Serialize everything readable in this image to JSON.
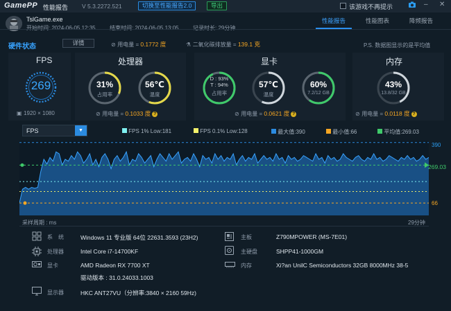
{
  "titlebar": {
    "brand": "GamePP",
    "brand_part1": "Game",
    "brand_part2": "PP",
    "name": "性能报告",
    "version": "V 5.3.2272.521",
    "switch_btn": "切换至性能报告2.0",
    "export_btn": "导出",
    "no_prompt_label": "该游戏不再提示"
  },
  "header": {
    "file_name": "TslGame.exe",
    "start_time": "开始时间: 2024-06-05 12:35",
    "end_time": "结束时间: 2024-06-05 13:05",
    "record_time": "记录时长: 29分钟",
    "tabs": [
      "性能报告",
      "性能图表",
      "降频报告"
    ]
  },
  "hw": {
    "label": "硬件状态",
    "detail_btn": "详情",
    "power_prefix": "用电量 = ",
    "power_value": "0.1772 度",
    "co2_prefix": "二氧化碳排放量 = ",
    "co2_value": "139.1 克",
    "note": "P.S. 数据图显示的是平均值"
  },
  "fps": {
    "title": "FPS",
    "value": "269",
    "resolution": "1920 × 1080"
  },
  "cpu": {
    "title": "处理器",
    "usage": "31%",
    "usage_label": "占用率",
    "usage_fraction": 0.31,
    "temp": "56℃",
    "temp_label": "温度",
    "temp_fraction": 0.56,
    "power_prefix": "用电量 = ",
    "power_value": "0.1033 度"
  },
  "gpu": {
    "title": "显卡",
    "d": "D : 93%",
    "t": "T : 94%",
    "usage_label": "占用率",
    "usage_fraction": 0.93,
    "temp": "57℃",
    "temp_label": "温度",
    "temp_fraction": 0.57,
    "vram": "60%",
    "vram_sub": "7.2/12 GB",
    "vram_fraction": 0.6,
    "power_prefix": "用电量 = ",
    "power_value": "0.0621 度"
  },
  "mem": {
    "title": "内存",
    "usage": "43%",
    "usage_sub": "13.8/32 GB",
    "usage_fraction": 0.43,
    "power_prefix": "用电量 = ",
    "power_value": "0.0118 度"
  },
  "chart": {
    "selected_metric": "FPS",
    "legend": [
      {
        "label": "FPS 1% Low:181",
        "color": "#7ff0f0"
      },
      {
        "label": "FPS 0.1% Low:128",
        "color": "#f2f06a"
      },
      {
        "label": "最大值:390",
        "color": "#2b8be0"
      },
      {
        "label": "最小值:66",
        "color": "#f5a623"
      },
      {
        "label": "平均值:269.03",
        "color": "#3fc96a"
      }
    ],
    "max_label": "390",
    "avg_label": "269.03",
    "min_label": "66",
    "x_start_label": "采样周期 : ms",
    "x_end_label": "29分钟"
  },
  "chart_data": {
    "type": "area",
    "title": "",
    "xlabel": "采样周期 : ms",
    "ylabel": "",
    "ylim": [
      0,
      400
    ],
    "series": [
      {
        "name": "FPS",
        "values": [
          66,
          140,
          150,
          140,
          150,
          145,
          150,
          235,
          300,
          275,
          310,
          290,
          340,
          330,
          270,
          300,
          290,
          320,
          300,
          340,
          320,
          280,
          300,
          330,
          270,
          300,
          260,
          310,
          330,
          300,
          250,
          300,
          320,
          290,
          310,
          340,
          270,
          300,
          290,
          330,
          310,
          280,
          300,
          320,
          260,
          300,
          330,
          310,
          290,
          330,
          300,
          320,
          340,
          280,
          300,
          310,
          290,
          330,
          300,
          260,
          320,
          300,
          310,
          280,
          330,
          300,
          320,
          290,
          310,
          300,
          330,
          270,
          300,
          320,
          290,
          310,
          300,
          330,
          280,
          300,
          320,
          300,
          310,
          290,
          330,
          300,
          310,
          280,
          320,
          300,
          310,
          290,
          300,
          320,
          310,
          300,
          290,
          330,
          300,
          310,
          280,
          320,
          300,
          310,
          290,
          300,
          330,
          310,
          300,
          290,
          310,
          320,
          300,
          290,
          310,
          300,
          330,
          300,
          310,
          290,
          300,
          320,
          310,
          300,
          290,
          310,
          300,
          320,
          300,
          310,
          290,
          300,
          320,
          300,
          310
        ]
      }
    ],
    "reference_lines": {
      "max": 390,
      "fps_1pct_low": 181,
      "fps_01pct_low": 128,
      "avg": 269.03,
      "min": 66
    }
  },
  "info": {
    "os_label": "系　统",
    "os_value": "Windows 11 专业版 64位 22631.3593 (23H2)",
    "cpu_label": "处理器",
    "cpu_value": "Intel Core i7-14700KF",
    "gpu_label": "显卡",
    "gpu_value": "AMD Radeon RX 7700 XT",
    "driver_value": "驱动版本 : 31.0.24033.1003",
    "monitor_label": "显示器",
    "monitor_value": "HKC ANT27VU（分辨率:3840 × 2160 59Hz)",
    "board_label": "主板",
    "board_value": "Z790MPOWER (MS-7E01)",
    "disk_label": "主硬盘",
    "disk_value": "SHPP41-1000GM",
    "mem_label": "内存",
    "mem_value": "Xi?an UnilC Semiconductors 32GB 8000MHz 38-5"
  },
  "colors": {
    "accent": "#2b8be0",
    "gauge_cpu": "#e4d84a",
    "gauge_green": "#3fc96a",
    "gauge_white": "#cfd6dc",
    "area_fill": "#1c5a96",
    "line": "#38a3ff"
  }
}
